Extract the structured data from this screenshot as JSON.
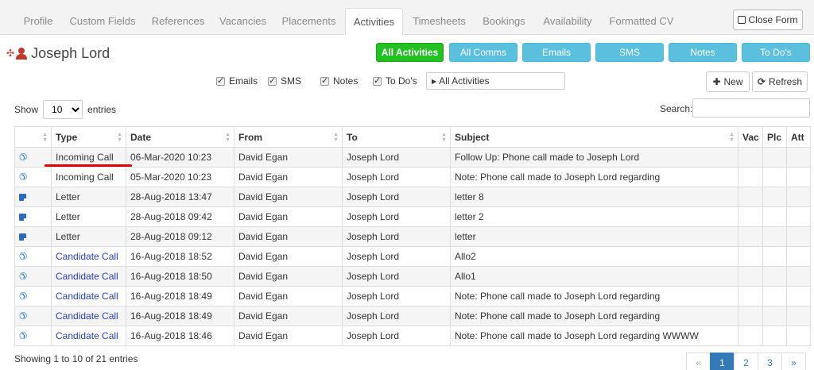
{
  "tabs": [
    {
      "label": "Profile"
    },
    {
      "label": "Custom Fields"
    },
    {
      "label": "References"
    },
    {
      "label": "Vacancies"
    },
    {
      "label": "Placements"
    },
    {
      "label": "Activities"
    },
    {
      "label": "Timesheets"
    },
    {
      "label": "Bookings"
    },
    {
      "label": "Availability"
    },
    {
      "label": "Formatted CV"
    }
  ],
  "active_tab": "Activities",
  "close_form_label": "Close Form",
  "candidate": {
    "name": "Joseph Lord"
  },
  "filter_buttons": [
    {
      "label": "All Activities"
    },
    {
      "label": "All Comms"
    },
    {
      "label": "Emails"
    },
    {
      "label": "SMS"
    },
    {
      "label": "Notes"
    },
    {
      "label": "To Do's"
    }
  ],
  "checkboxes": [
    {
      "label": "Emails",
      "checked": true
    },
    {
      "label": "SMS",
      "checked": true
    },
    {
      "label": "Notes",
      "checked": true
    },
    {
      "label": "To Do's",
      "checked": true
    }
  ],
  "activity_select": {
    "value": "All Activities"
  },
  "new_label": "New",
  "refresh_label": "Refresh",
  "length": {
    "show": "Show",
    "value": "10",
    "entries": "entries"
  },
  "search_label": "Search:",
  "table": {
    "columns": [
      "",
      "Type",
      "Date",
      "From",
      "To",
      "Subject",
      "Vac",
      "Plc",
      "Att"
    ],
    "rows": [
      {
        "icon": "phone",
        "type": "Incoming Call",
        "link": false,
        "date": "06-Mar-2020 10:23",
        "from": "David Egan",
        "to": "Joseph Lord",
        "subject": "Follow Up: Phone call made to Joseph Lord"
      },
      {
        "icon": "phone",
        "type": "Incoming Call",
        "link": false,
        "date": "05-Mar-2020 10:23",
        "from": "David Egan",
        "to": "Joseph Lord",
        "subject": "Note: Phone call made to Joseph Lord regarding"
      },
      {
        "icon": "letter",
        "type": "Letter",
        "link": false,
        "date": "28-Aug-2018 13:47",
        "from": "David Egan",
        "to": "Joseph Lord",
        "subject": "letter 8"
      },
      {
        "icon": "letter",
        "type": "Letter",
        "link": false,
        "date": "28-Aug-2018 09:42",
        "from": "David Egan",
        "to": "Joseph Lord",
        "subject": "letter 2"
      },
      {
        "icon": "letter",
        "type": "Letter",
        "link": false,
        "date": "28-Aug-2018 09:12",
        "from": "David Egan",
        "to": "Joseph Lord",
        "subject": "letter"
      },
      {
        "icon": "phone",
        "type": "Candidate Call",
        "link": true,
        "date": "16-Aug-2018 18:52",
        "from": "David Egan",
        "to": "Joseph Lord",
        "subject": "Allo2"
      },
      {
        "icon": "phone",
        "type": "Candidate Call",
        "link": true,
        "date": "16-Aug-2018 18:50",
        "from": "David Egan",
        "to": "Joseph Lord",
        "subject": "Allo1"
      },
      {
        "icon": "phone",
        "type": "Candidate Call",
        "link": true,
        "date": "16-Aug-2018 18:49",
        "from": "David Egan",
        "to": "Joseph Lord",
        "subject": "Note: Phone call made to Joseph Lord regarding"
      },
      {
        "icon": "phone",
        "type": "Candidate Call",
        "link": true,
        "date": "16-Aug-2018 18:49",
        "from": "David Egan",
        "to": "Joseph Lord",
        "subject": "Note: Phone call made to Joseph Lord regarding"
      },
      {
        "icon": "phone",
        "type": "Candidate Call",
        "link": true,
        "date": "16-Aug-2018 18:46",
        "from": "David Egan",
        "to": "Joseph Lord",
        "subject": "Note: Phone call made to Joseph Lord regarding WWWW"
      }
    ]
  },
  "footer": {
    "info": "Showing 1 to 10 of 21 entries"
  },
  "pagination": [
    "«",
    "1",
    "2",
    "3",
    "»"
  ],
  "pagination_active": "1",
  "colors": {
    "active_filter": "#22c122",
    "filter": "#5bc0de",
    "link": "#2a3ebb",
    "annotation": "#dd0000"
  }
}
